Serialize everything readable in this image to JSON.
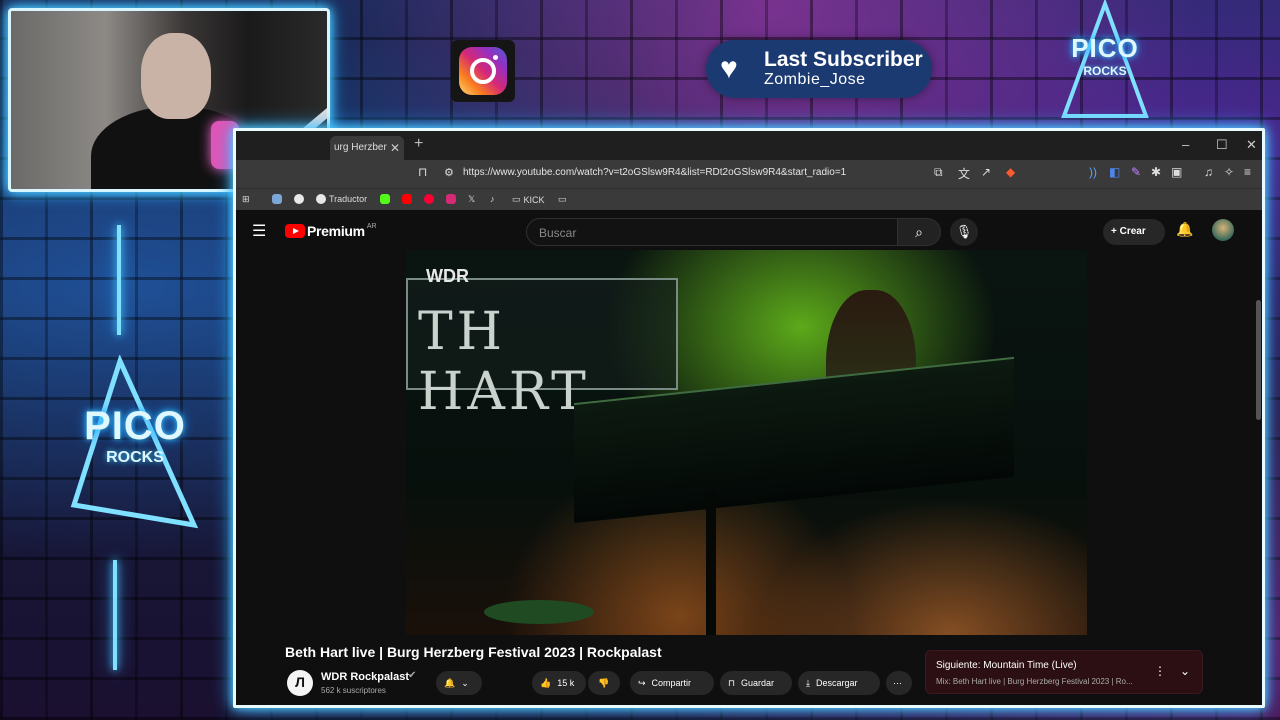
{
  "overlay": {
    "subscriber_title": "Last Subscriber",
    "subscriber_name": "Zombie_Jose",
    "logo_text_1": "PICO",
    "logo_text_2": "ROCKS"
  },
  "browser": {
    "tab_title": "urg Herzber",
    "url": "https://www.youtube.com/watch?v=t2oGSlsw9R4&list=RDt2oGSlsw9R4&start_radio=1",
    "bookmarks": [
      "Traductor",
      "KICK"
    ]
  },
  "youtube": {
    "logo_word": "Premium",
    "region": "AR",
    "search_placeholder": "Buscar",
    "create_label": "Crear",
    "video": {
      "banner_text": "TH HART",
      "watermark": "WDR",
      "title": "Beth Hart live | Burg Herzberg Festival 2023 | Rockpalast",
      "channel_name": "WDR Rockpalast",
      "subscribers": "562 k suscriptores",
      "likes": "15 k"
    },
    "actions": {
      "share": "Compartir",
      "save": "Guardar",
      "download": "Descargar"
    },
    "next": {
      "title": "Siguiente: Mountain Time (Live)",
      "subtitle": "Mix: Beth Hart live | Burg Herzberg Festival 2023 | Ro..."
    }
  }
}
